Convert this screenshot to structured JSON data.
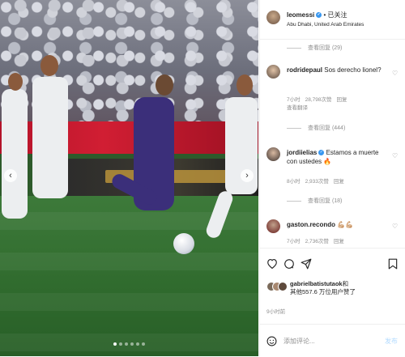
{
  "post": {
    "author": "leomessi",
    "follow_status": "已关注",
    "location": "Abu Dhabi, United Arab Emirates",
    "view_replies_top": "查看回复 (29)"
  },
  "comments": [
    {
      "username": "rodridepaul",
      "text": "Sos derecho lionel?",
      "time": "7小时",
      "likes": "28,798次赞",
      "reply": "回复",
      "translation": "查看翻译",
      "replies": "查看回复 (444)"
    },
    {
      "username": "jordiielias",
      "text": "Estamos a muerte con ustedes",
      "emoji": "🔥",
      "time": "8小时",
      "likes": "2,933次赞",
      "reply": "回复",
      "replies": "查看回复 (18)"
    },
    {
      "username": "gaston.recondo",
      "text": "💪🏼💪🏼",
      "time": "7小时",
      "likes": "2,736次赞",
      "reply": "回复"
    }
  ],
  "likes_block": {
    "liker": "gabrielbatistutaok",
    "liker_suffix": "和",
    "others": "其他557.6 万位用户赞了",
    "time_ago": "9小时前"
  },
  "composer": {
    "placeholder": "添加评论...",
    "post_button": "发布"
  },
  "icons": {
    "verified": "verified-badge-icon",
    "more": "more-options-icon",
    "heart": "heart-icon",
    "comment": "comment-icon",
    "share": "share-icon",
    "save": "bookmark-icon",
    "emoji": "emoji-icon"
  },
  "colors": {
    "accent": "#3897f0",
    "muted": "#8e8e8e",
    "text": "#262626"
  }
}
